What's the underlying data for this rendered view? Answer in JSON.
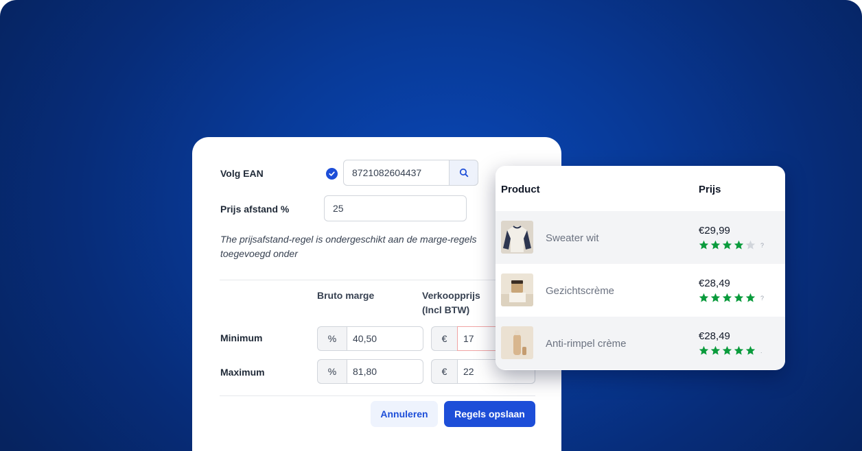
{
  "form": {
    "follow_ean_label": "Volg EAN",
    "follow_ean_checked": true,
    "ean_value": "8721082604437",
    "price_distance_label": "Prijs afstand %",
    "price_distance_value": "25",
    "note": "The prijsafstand-regel is ondergeschikt aan de marge-regels",
    "note_line2": "toegevoegd onder",
    "col_gross_margin": "Bruto marge",
    "col_sale_price_line1": "Verkoopprijs",
    "col_sale_price_line2": "(Incl BTW)",
    "rows": [
      {
        "label": "Minimum",
        "margin_unit": "%",
        "margin_value": "40,50",
        "price_unit": "€",
        "price_value": "17"
      },
      {
        "label": "Maximum",
        "margin_unit": "%",
        "margin_value": "81,80",
        "price_unit": "€",
        "price_value": "22"
      }
    ],
    "cancel_label": "Annuleren",
    "save_label": "Regels opslaan"
  },
  "products": {
    "col_product": "Product",
    "col_price": "Prijs",
    "items": [
      {
        "name": "Sweater wit",
        "price": "€29,99",
        "rating": 4,
        "max_rating": 5,
        "marker": "?"
      },
      {
        "name": "Gezichtscrème",
        "price": "€28,49",
        "rating": 5,
        "max_rating": 5,
        "marker": "?"
      },
      {
        "name": "Anti-rimpel crème",
        "price": "€28,49",
        "rating": 5,
        "max_rating": 5,
        "marker": "."
      }
    ]
  },
  "colors": {
    "background": "#0a48b8",
    "accent": "#1d4ed8",
    "star_filled": "#0a9b3c",
    "star_empty": "#d1d5db"
  }
}
